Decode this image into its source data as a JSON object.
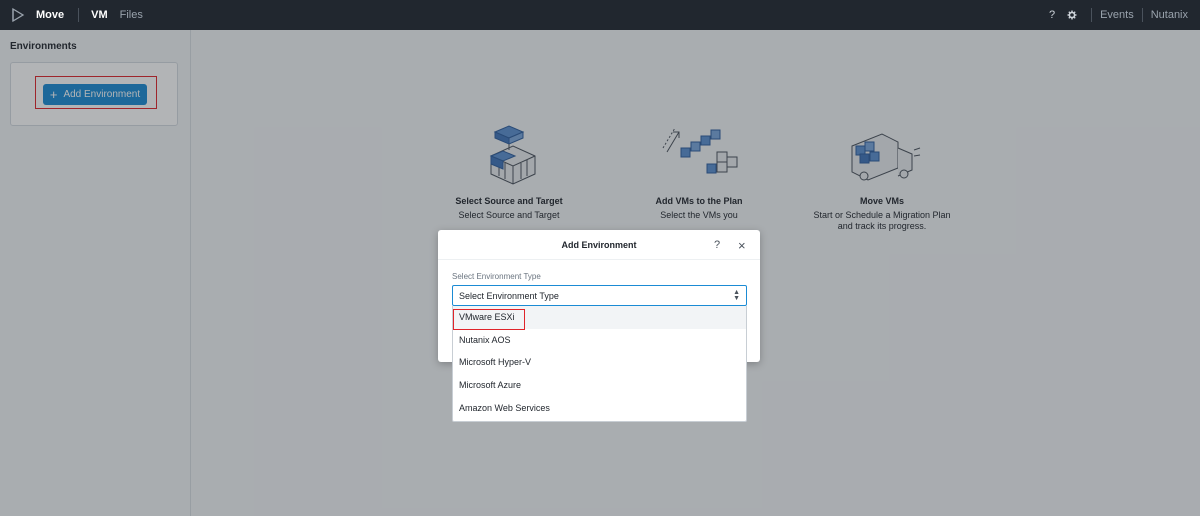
{
  "topbar": {
    "app_name": "Move",
    "tabs": [
      {
        "label": "VM",
        "active": true
      },
      {
        "label": "Files",
        "active": false
      }
    ],
    "right": {
      "help": "?",
      "events": "Events",
      "user": "Nutanix"
    }
  },
  "sidebar": {
    "title": "Environments",
    "add_button_label": "Add Environment"
  },
  "steps": [
    {
      "title": "Select Source and Target",
      "desc": "Select Source and Target",
      "icon": "stacked-blocks-icon"
    },
    {
      "title": "Add VMs to the Plan",
      "desc": "Select the VMs you",
      "icon": "moving-cubes-icon"
    },
    {
      "title": "Move VMs",
      "desc": "Start or Schedule a Migration Plan and track its progress.",
      "icon": "truck-icon"
    }
  ],
  "modal": {
    "title": "Add Environment",
    "help": "?",
    "close": "×",
    "field_label": "Select Environment Type",
    "select_value": "Select Environment Type",
    "options": [
      "VMware ESXi",
      "Nutanix AOS",
      "Microsoft Hyper-V",
      "Microsoft Azure",
      "Amazon Web Services"
    ]
  },
  "colors": {
    "topbar": "#21272f",
    "accent": "#1b8bd4",
    "highlight": "#e0242a"
  }
}
